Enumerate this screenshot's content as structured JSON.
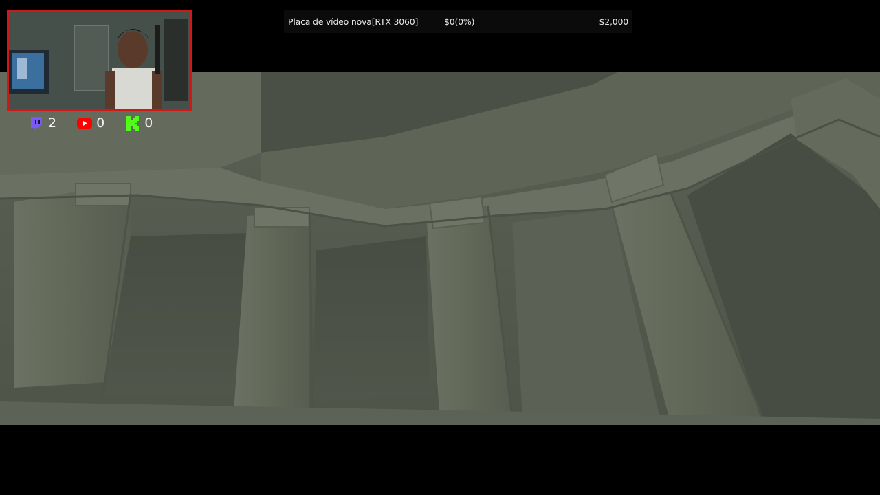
{
  "goal": {
    "title": "Placa de vídeo nova[RTX 3060]",
    "progress_text": "$0(0%)",
    "target_text": "$2,000",
    "progress_fraction": 0.0,
    "fill_color": "#3a8f3a"
  },
  "viewers": [
    {
      "platform": "twitch-icon",
      "count": "2",
      "color": "#7a5af5"
    },
    {
      "platform": "youtube-icon",
      "count": "0",
      "color": "#ff0000"
    },
    {
      "platform": "kick-icon",
      "count": "0",
      "color": "#53fc18"
    }
  ],
  "webcam": {
    "border_color": "#d01818"
  }
}
